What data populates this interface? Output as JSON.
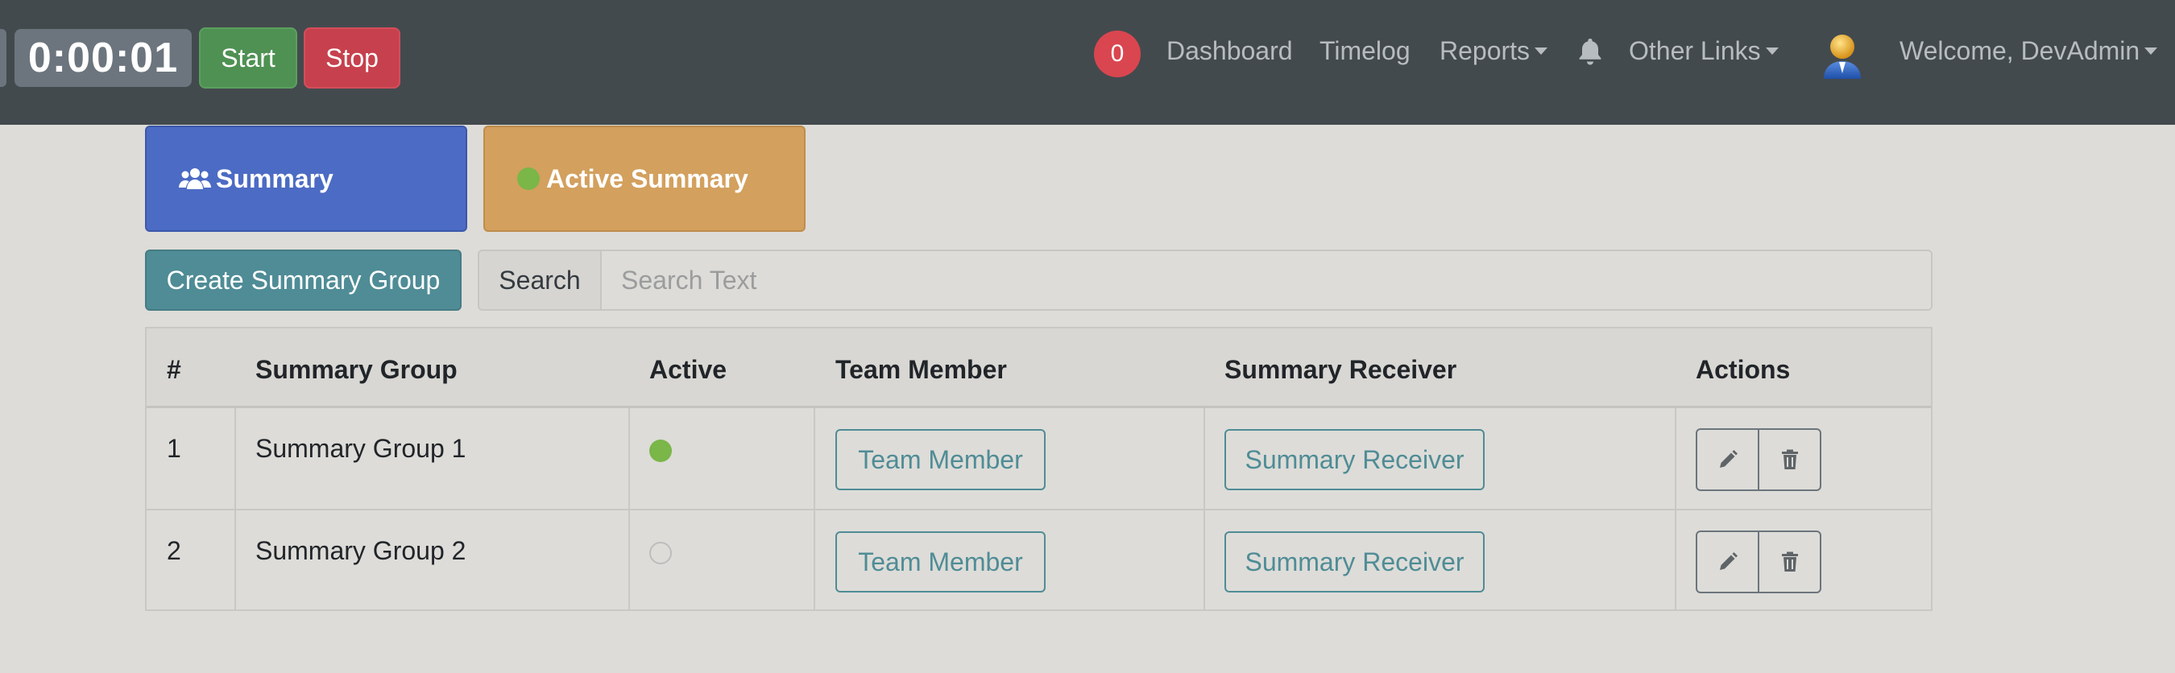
{
  "navbar": {
    "timer": "0:00:01",
    "start_label": "Start",
    "stop_label": "Stop",
    "notification_count": "0",
    "links": {
      "dashboard": "Dashboard",
      "timelog": "Timelog",
      "reports": "Reports",
      "other_links": "Other Links"
    },
    "welcome": "Welcome, DevAdmin"
  },
  "tabs": {
    "summary": "Summary",
    "active_summary": "Active Summary"
  },
  "toolbar": {
    "create_label": "Create Summary Group",
    "search_label": "Search",
    "search_placeholder": "Search Text",
    "search_value": ""
  },
  "table": {
    "headers": [
      "#",
      "Summary Group",
      "Active",
      "Team Member",
      "Summary Receiver",
      "Actions"
    ],
    "rows": [
      {
        "num": "1",
        "group": "Summary Group 1",
        "active": true,
        "team_btn": "Team Member",
        "receiver_btn": "Summary Receiver"
      },
      {
        "num": "2",
        "group": "Summary Group 2",
        "active": false,
        "team_btn": "Team Member",
        "receiver_btn": "Summary Receiver"
      }
    ]
  },
  "colors": {
    "navbar_bg": "#434a4e",
    "start": "#4f9153",
    "stop": "#c6414d",
    "badge": "#d9464f",
    "summary_tab": "#4c6bc4",
    "active_tab": "#d3a05e",
    "create_btn": "#4f8c96",
    "active_green": "#7ab648"
  },
  "icons": {
    "summary_tab": "users-icon",
    "active_tab": "green-dot-icon",
    "notification": "bell-icon",
    "user": "avatar-icon",
    "edit": "pencil-icon",
    "delete": "trash-icon"
  }
}
